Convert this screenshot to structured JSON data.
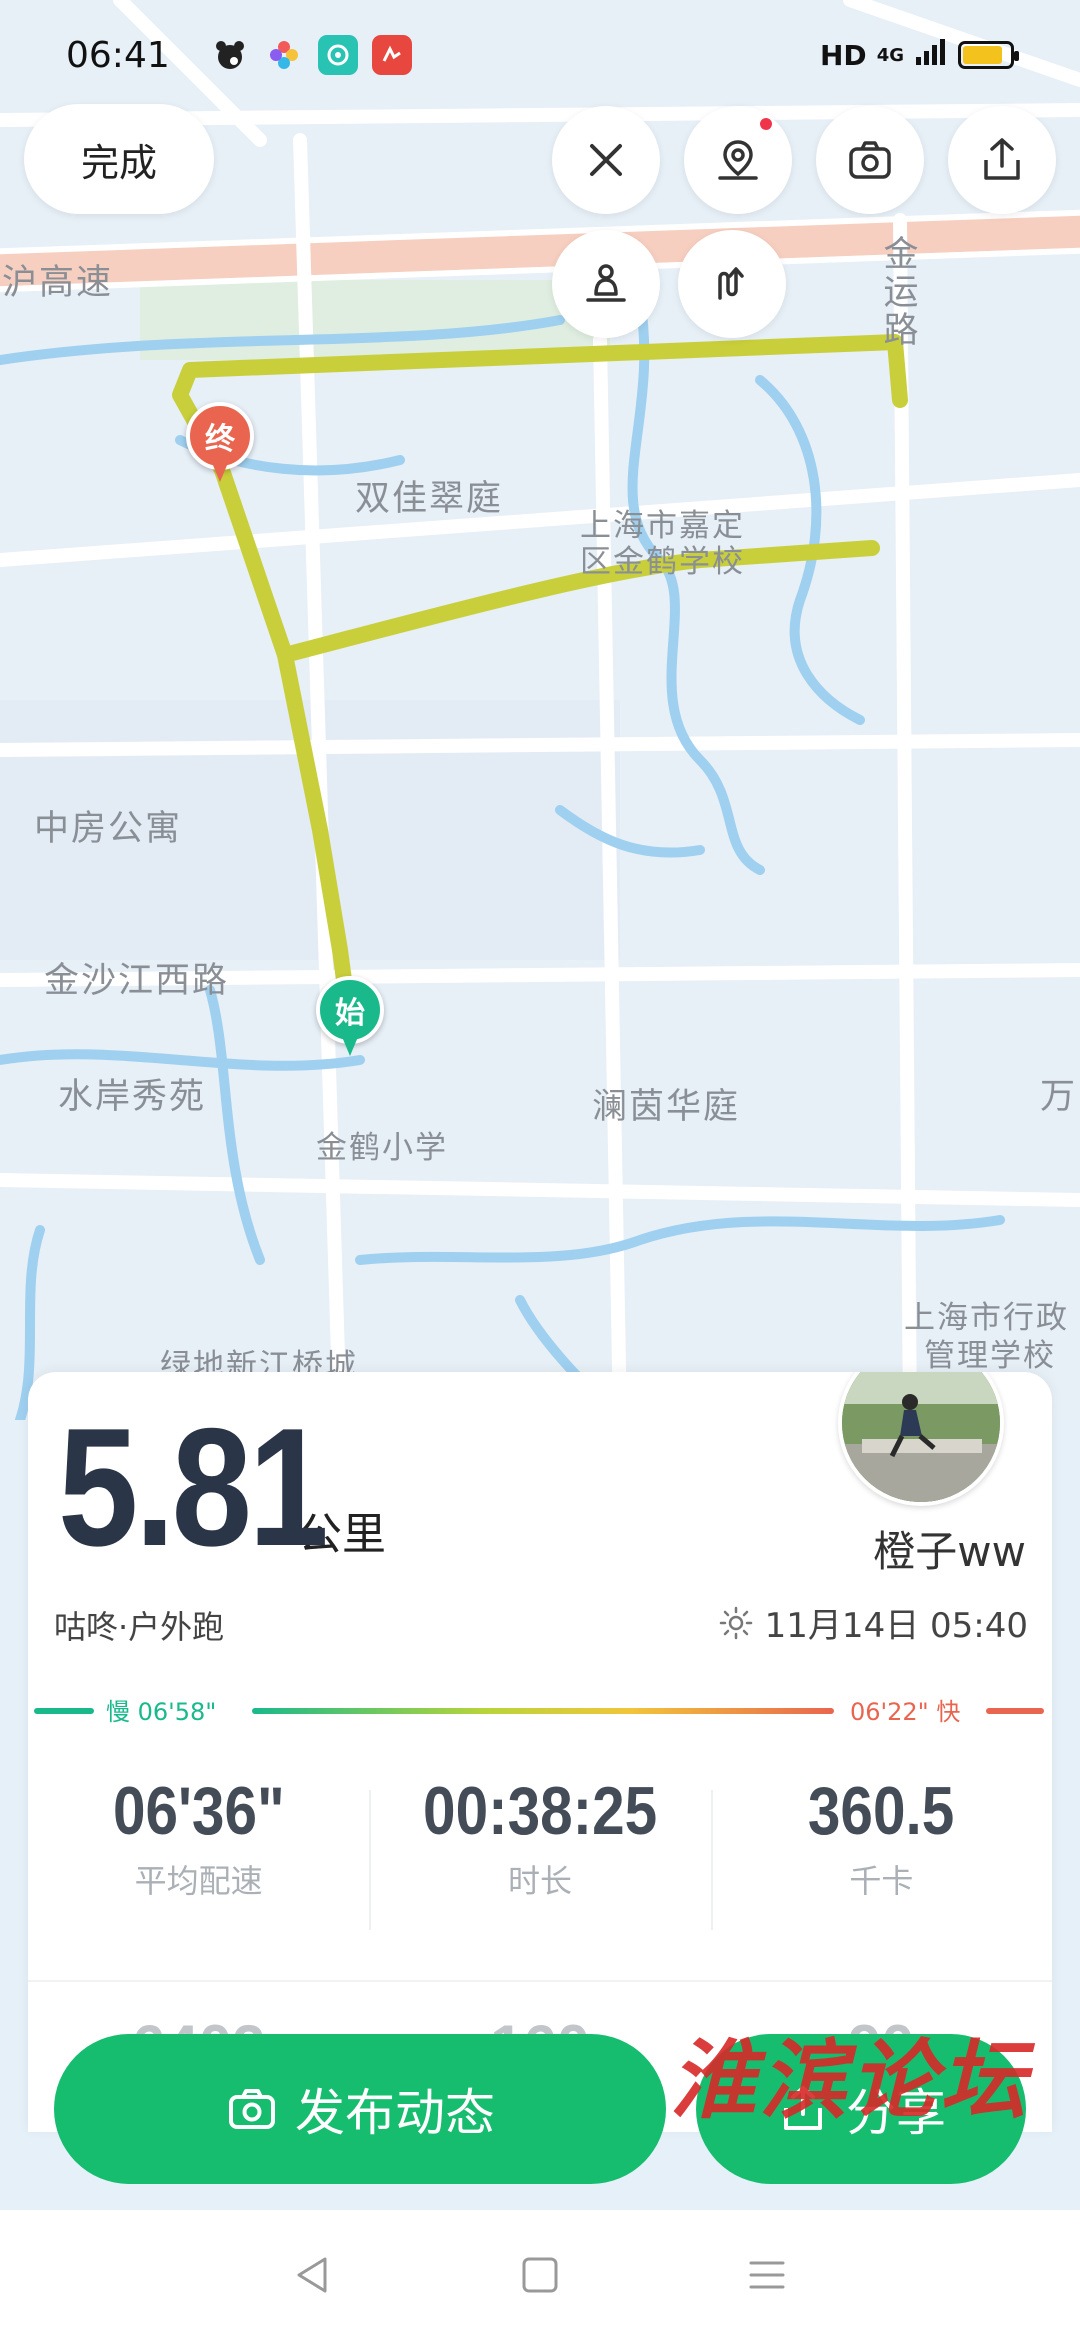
{
  "status_bar": {
    "time": "06:41",
    "network_label": "HD",
    "signal_label": "4G",
    "battery_level": 0.85,
    "battery_color": "#f4c21d"
  },
  "toolbar": {
    "done_label": "完成",
    "buttons": [
      "close-icon",
      "map-pin-icon",
      "camera-icon",
      "share-icon",
      "person-icon",
      "route-icon"
    ],
    "notification_dot_color": "#f0344a"
  },
  "map": {
    "labels": {
      "highway": "沪高速",
      "jinyun_road": "金运路",
      "shuangjia": "双佳翠庭",
      "school_line1": "上海市嘉定",
      "school_line2": "区金鹤学校",
      "zhongfang": "中房公寓",
      "jinshajiang": "金沙江西路",
      "shuian": "水岸秀苑",
      "lanyin": "澜茵华庭",
      "wan": "万",
      "jinhe_primary": "金鹤小学",
      "admin_school_line1": "上海市行政",
      "admin_school_line2": "管理学校",
      "lvdi": "绿地新江桥城",
      "edge_char": "江"
    },
    "route_color": "#c9cf3a",
    "start_marker": "始",
    "end_marker": "终",
    "start_color": "#19b98c",
    "end_color": "#e9654f"
  },
  "card": {
    "distance_value": "5.81",
    "distance_unit": "公里",
    "username": "橙子ww",
    "sport_type": "咕咚·户外跑",
    "datetime": "11月14日 05:40",
    "weather_icon": "sun-icon",
    "pace_slow_label": "慢 06'58\"",
    "pace_fast_label": "06'22\" 快",
    "pace_slow_color": "#19b98c",
    "pace_fast_color": "#e9654f",
    "metrics": [
      {
        "value": "06'36\"",
        "label": "平均配速"
      },
      {
        "value": "00:38:25",
        "label": "时长"
      },
      {
        "value": "360.5",
        "label": "千卡"
      }
    ],
    "partial_metrics": [
      "6402",
      "160",
      "90"
    ]
  },
  "actions": {
    "post_label": "发布动态",
    "share_label": "分享",
    "accent_color": "#16bd6f"
  },
  "watermark": "淮滨论坛",
  "nav_bar": [
    "back-icon",
    "home-icon",
    "menu-icon"
  ]
}
